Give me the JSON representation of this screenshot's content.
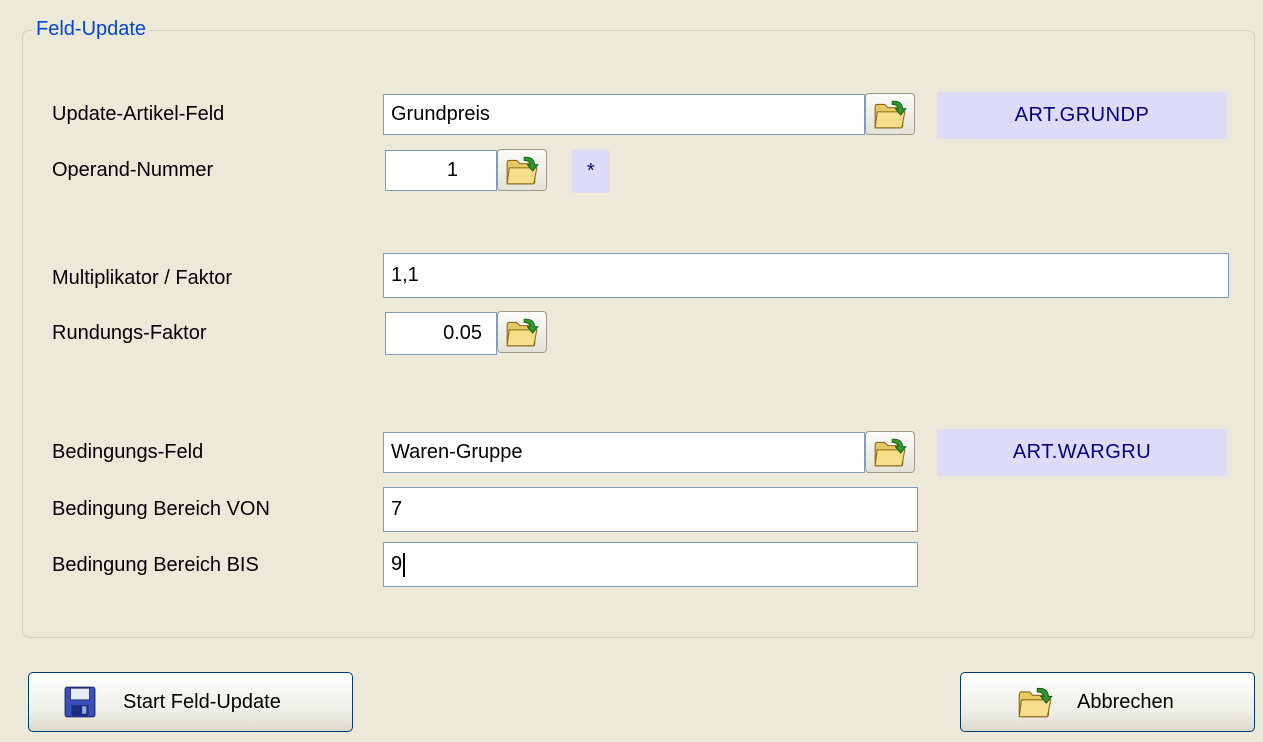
{
  "group": {
    "legend": "Feld-Update"
  },
  "fields": {
    "update_field": {
      "label": "Update-Artikel-Feld",
      "value": "Grundpreis",
      "code": "ART.GRUNDP"
    },
    "operand": {
      "label": "Operand-Nummer",
      "value": "1",
      "operator": "*"
    },
    "multiplier": {
      "label": "Multiplikator / Faktor",
      "value": "1,1"
    },
    "rounding": {
      "label": "Rundungs-Faktor",
      "value": "0.05"
    },
    "condition_field": {
      "label": "Bedingungs-Feld",
      "value": "Waren-Gruppe",
      "code": "ART.WARGRU"
    },
    "range_from": {
      "label": "Bedingung Bereich VON",
      "value": "7"
    },
    "range_to": {
      "label": "Bedingung Bereich BIS",
      "value": "9"
    }
  },
  "buttons": {
    "start": {
      "label": "Start Feld-Update",
      "icon": "floppy-disk-icon"
    },
    "cancel": {
      "label": "Abbrechen",
      "icon": "folder-arrow-icon"
    }
  },
  "icons": {
    "picker": "folder-arrow-icon"
  },
  "colors": {
    "background": "#ece9d8",
    "legend": "#0046d5",
    "badge_bg": "#dcdcf8",
    "badge_text": "#000080"
  }
}
